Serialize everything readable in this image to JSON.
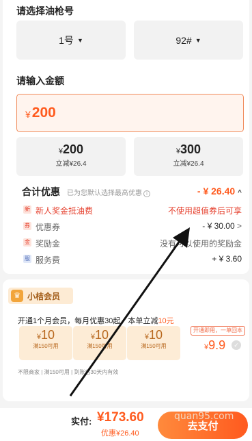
{
  "gun_section": {
    "title": "请选择油枪号",
    "gun": "1号",
    "fuel": "92#"
  },
  "amount_section": {
    "title": "请输入金额",
    "currency": "¥",
    "value": "200",
    "presets": [
      {
        "currency": "¥",
        "amount": "200",
        "discount": "立减¥26.4"
      },
      {
        "currency": "¥",
        "amount": "300",
        "discount": "立减¥26.4"
      }
    ]
  },
  "discount_summary": {
    "title": "合计优惠",
    "hint": "已为您默认选择最高优惠",
    "info_icon": "i",
    "value": "- ¥ 26.40",
    "chevron": "^",
    "rows": [
      {
        "tag": "新",
        "label": "新人奖金抵油费",
        "value": "不使用超值券后可享"
      },
      {
        "tag": "券",
        "label": "优惠券",
        "value": "- ¥ 30.00",
        "chevron": ">"
      },
      {
        "tag": "金",
        "label": "奖励金",
        "value": "没有可以使用的奖励金"
      },
      {
        "tag": "服",
        "label": "服务费",
        "value": "+ ¥ 3.60"
      }
    ]
  },
  "vip": {
    "crown_icon": "♛",
    "title": "小桔会员",
    "desc_prefix": "开通1个月会员，每月优惠30起，本单立减",
    "desc_highlight": "10元",
    "coupons": [
      {
        "currency": "¥",
        "amount": "10",
        "condition": "满150可用"
      },
      {
        "currency": "¥",
        "amount": "10",
        "condition": "满150可用"
      },
      {
        "currency": "¥",
        "amount": "10",
        "condition": "满150可用"
      }
    ],
    "badge": "开通即用，一单回本",
    "price_currency": "¥",
    "price": "9.9",
    "footnote": "不限商家 | 满150可用 | 到账后30天内有效"
  },
  "bottom": {
    "pay_label": "实付:",
    "pay_amount": "¥173.60",
    "discount_label": "优惠¥26.40",
    "pay_button": "去支付"
  },
  "watermark": "quan95.com",
  "colors": {
    "accent": "#ff5b1f",
    "vip_gold": "#b8681e",
    "arrow": "#111111"
  }
}
